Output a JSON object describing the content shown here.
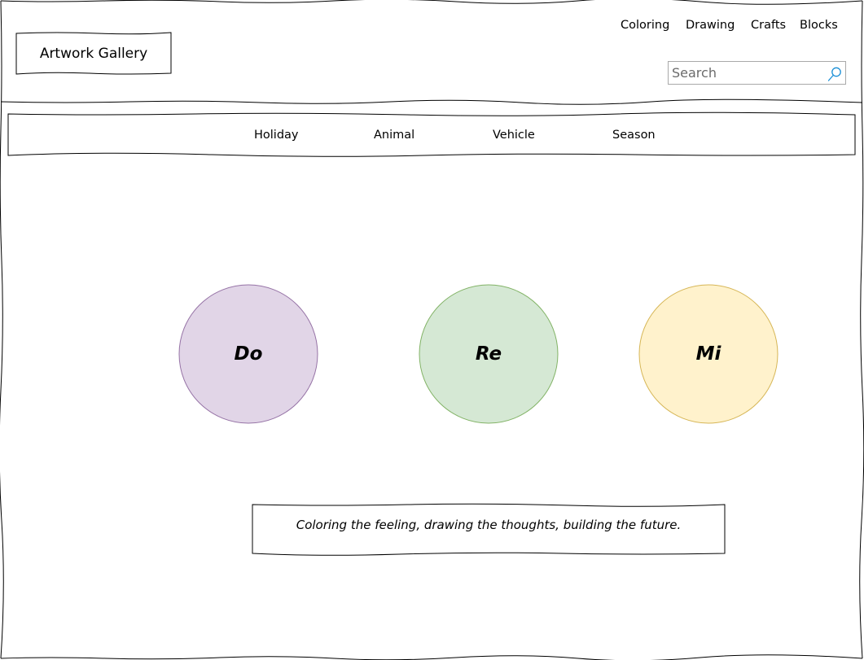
{
  "header": {
    "logo_text": "Artwork Gallery",
    "nav": [
      {
        "label": "Coloring"
      },
      {
        "label": "Drawing"
      },
      {
        "label": "Crafts"
      },
      {
        "label": "Blocks"
      }
    ],
    "search": {
      "placeholder": "Search",
      "value": ""
    }
  },
  "categories": [
    {
      "label": "Holiday"
    },
    {
      "label": "Animal"
    },
    {
      "label": "Vehicle"
    },
    {
      "label": "Season"
    }
  ],
  "circles": [
    {
      "label": "Do",
      "fill": "#e1d5e7",
      "stroke": "#9673a6"
    },
    {
      "label": "Re",
      "fill": "#d5e8d4",
      "stroke": "#82b366"
    },
    {
      "label": "Mi",
      "fill": "#fff2cc",
      "stroke": "#d6b656"
    }
  ],
  "tagline": "Coloring the feeling, drawing the thoughts, building the future.",
  "colors": {
    "search_icon": "#1a8fd6",
    "sketch_line": "#000000"
  }
}
